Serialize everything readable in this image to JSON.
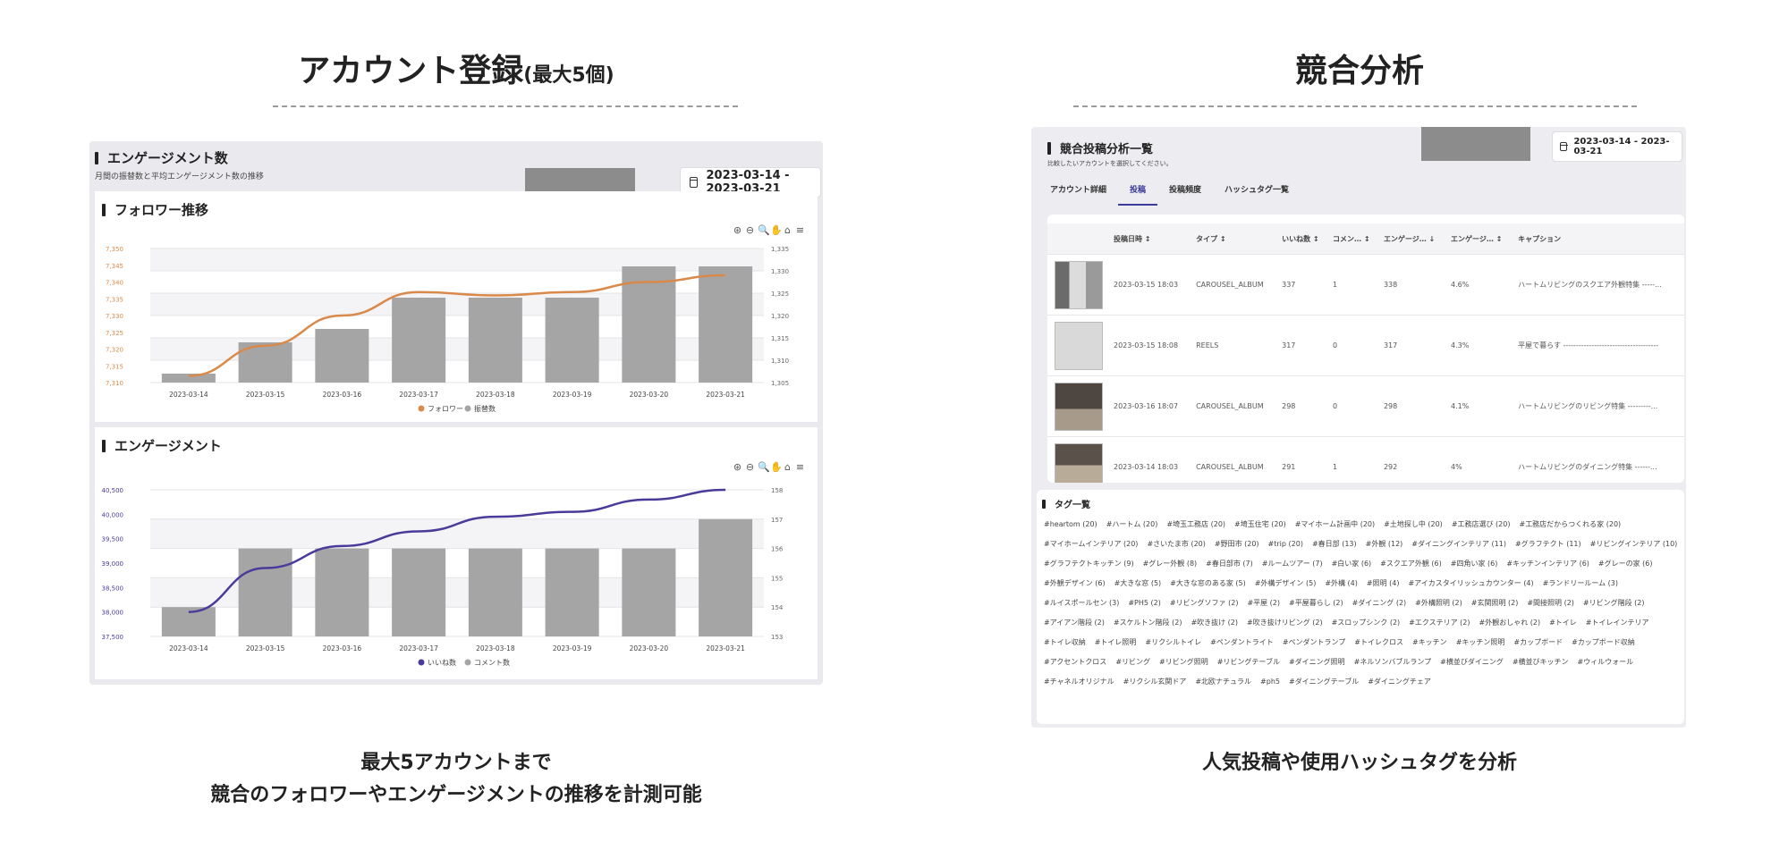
{
  "left": {
    "heading_main": "アカウント登録",
    "heading_sub": "(最大5個)",
    "caption_line1": "最大5アカウントまで",
    "caption_line2": "競合のフォロワーやエンゲージメントの推移を計測可能",
    "panel_title": "エンゲージメント数",
    "panel_desc": "月間の振替数と平均エンゲージメント数の推移",
    "date_range": "2023-03-14 - 2023-03-21"
  },
  "right": {
    "heading": "競合分析",
    "caption": "人気投稿や使用ハッシュタグを分析",
    "panel_title": "競合投稿分析一覧",
    "panel_desc": "比較したいアカウントを選択してください。",
    "date_range": "2023-03-14 - 2023-03-21",
    "tabs": [
      "アカウント詳細",
      "投稿",
      "投稿頻度",
      "ハッシュタグ一覧"
    ],
    "active_tab": 1,
    "table": {
      "columns": [
        "",
        "投稿日時 ↕",
        "タイプ ↕",
        "いいね数 ↕",
        "コメン… ↕",
        "エンゲージ… ↓",
        "エンゲージ… ↕",
        "キャプション"
      ],
      "rows": [
        {
          "date": "2023-03-15 18:03",
          "type": "CAROUSEL_ALBUM",
          "likes": "337",
          "comments": "1",
          "eng": "338",
          "rate": "4.6%",
          "caption": "ハートムリビングのスクエア外観特集 -----..."
        },
        {
          "date": "2023-03-15 18:08",
          "type": "REELS",
          "likes": "317",
          "comments": "0",
          "eng": "317",
          "rate": "4.3%",
          "caption": "平屋で暮らす -------------------------------------"
        },
        {
          "date": "2023-03-16 18:07",
          "type": "CAROUSEL_ALBUM",
          "likes": "298",
          "comments": "0",
          "eng": "298",
          "rate": "4.1%",
          "caption": "ハートムリビングのリビング特集 ---------..."
        },
        {
          "date": "2023-03-14 18:03",
          "type": "CAROUSEL_ALBUM",
          "likes": "291",
          "comments": "1",
          "eng": "292",
          "rate": "4%",
          "caption": "ハートムリビングのダイニング特集 ------..."
        }
      ]
    },
    "tag_title": "タグ一覧",
    "tags": [
      "#heartom (20)",
      "#ハートム (20)",
      "#埼玉工務店 (20)",
      "#埼玉住宅 (20)",
      "#マイホーム計画中 (20)",
      "#土地探し中 (20)",
      "#工務店選び (20)",
      "#工務店だからつくれる家 (20)",
      "#マイホームインテリア (20)",
      "#さいたま市 (20)",
      "#野田市 (20)",
      "#trip (20)",
      "#春日部 (13)",
      "#外観 (12)",
      "#ダイニングインテリア (11)",
      "#グラフテクト (11)",
      "#リビングインテリア (10)",
      "#グラフテクトキッチン (9)",
      "#グレー外観 (8)",
      "#春日部市 (7)",
      "#ルームツアー (7)",
      "#白い家 (6)",
      "#スクエア外観 (6)",
      "#四角い家 (6)",
      "#キッチンインテリア (6)",
      "#グレーの家 (6)",
      "#外観デザイン (6)",
      "#大きな窓 (5)",
      "#大きな窓のある家 (5)",
      "#外構デザイン (5)",
      "#外構 (4)",
      "#照明 (4)",
      "#アイカスタイリッシュカウンター (4)",
      "#ランドリールーム (3)",
      "#ルイスポールセン (3)",
      "#PH5 (2)",
      "#リビングソファ (2)",
      "#平屋 (2)",
      "#平屋暮らし (2)",
      "#ダイニング (2)",
      "#外構照明 (2)",
      "#玄関照明 (2)",
      "#間接照明 (2)",
      "#リビング階段 (2)",
      "#アイアン階段 (2)",
      "#スケルトン階段 (2)",
      "#吹き抜け (2)",
      "#吹き抜けリビング (2)",
      "#スロップシンク (2)",
      "#エクステリア (2)",
      "#外観おしゃれ (2)",
      "#トイレ",
      "#トイレインテリア",
      "#トイレ収納",
      "#トイレ照明",
      "#リクシルトイレ",
      "#ペンダントライト",
      "#ペンダントランプ",
      "#トイレクロス",
      "#キッチン",
      "#キッチン照明",
      "#カップボード",
      "#カップボード収納",
      "#アクセントクロス",
      "#リビング",
      "#リビング照明",
      "#リビングテーブル",
      "#ダイニング照明",
      "#ネルソンバブルランプ",
      "#横並びダイニング",
      "#横並びキッチン",
      "#ウィルウォール",
      "#チャネルオリジナル",
      "#リクシル玄関ドア",
      "#北欧ナチュラル",
      "#ph5",
      "#ダイニングテーブル",
      "#ダイニングチェア"
    ]
  },
  "colors": {
    "follower_line": "#d98a4a",
    "like_line": "#4a3a9a",
    "bar": "#a5a5a5",
    "active_tab": "#3b3b9a"
  },
  "chart_data": [
    {
      "type": "bar",
      "title": "フォロワー推移",
      "categories": [
        "2023-03-14",
        "2023-03-15",
        "2023-03-16",
        "2023-03-17",
        "2023-03-18",
        "2023-03-19",
        "2023-03-20",
        "2023-03-21"
      ],
      "series": [
        {
          "name": "フォロワー",
          "type": "line",
          "axis": "left",
          "values": [
            7312,
            7321,
            7330,
            7337,
            7336,
            7337,
            7340,
            7342
          ]
        },
        {
          "name": "振替数",
          "type": "bar",
          "axis": "right",
          "values": [
            1307,
            1314,
            1317,
            1324,
            1324,
            1324,
            1331,
            1331
          ]
        }
      ],
      "left_ticks": [
        "7,310",
        "7,315",
        "7,320",
        "7,325",
        "7,330",
        "7,335",
        "7,340",
        "7,345",
        "7,350"
      ],
      "right_ticks": [
        "1,305",
        "1,310",
        "1,315",
        "1,320",
        "1,325",
        "1,330",
        "1,335"
      ],
      "ylim_left": [
        7310,
        7350
      ],
      "ylim_right": [
        1305,
        1335
      ],
      "legend": [
        "フォロワー",
        "振替数"
      ],
      "legend_position": "bottom",
      "grid": true
    },
    {
      "type": "bar",
      "title": "エンゲージメント",
      "categories": [
        "2023-03-14",
        "2023-03-15",
        "2023-03-16",
        "2023-03-17",
        "2023-03-18",
        "2023-03-19",
        "2023-03-20",
        "2023-03-21"
      ],
      "series": [
        {
          "name": "いいね数",
          "type": "line",
          "axis": "left",
          "values": [
            38000,
            38900,
            39350,
            39650,
            39950,
            40050,
            40300,
            40500
          ]
        },
        {
          "name": "コメント数",
          "type": "bar",
          "axis": "right",
          "values": [
            154,
            156,
            156,
            156,
            156,
            156,
            156,
            157
          ]
        }
      ],
      "left_ticks": [
        "37,500",
        "38,000",
        "38,500",
        "39,000",
        "39,500",
        "40,000",
        "40,500"
      ],
      "right_ticks": [
        "153",
        "154",
        "155",
        "156",
        "157",
        "158"
      ],
      "ylim_left": [
        37500,
        40500
      ],
      "ylim_right": [
        153,
        158
      ],
      "legend": [
        "いいね数",
        "コメント数"
      ],
      "legend_position": "bottom",
      "grid": true
    }
  ]
}
